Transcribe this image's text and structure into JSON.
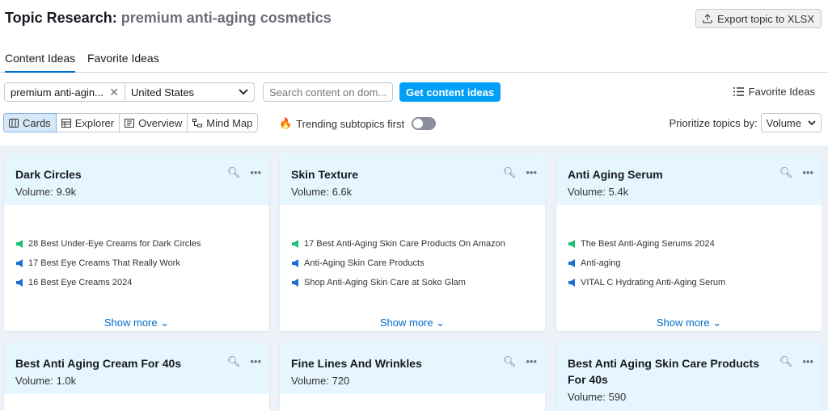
{
  "header": {
    "title": "Topic Research:",
    "query": "premium anti-aging cosmetics",
    "export_label": "Export topic to XLSX"
  },
  "tabs": [
    {
      "label": "Content Ideas",
      "active": true
    },
    {
      "label": "Favorite Ideas",
      "active": false
    }
  ],
  "filters": {
    "topic_chip": "premium anti-agin...",
    "country": "United States",
    "search_placeholder": "Search content on dom...",
    "go_label": "Get content ideas",
    "favorite_link": "Favorite Ideas"
  },
  "views": [
    {
      "label": "Cards",
      "icon": "cards-icon",
      "active": true
    },
    {
      "label": "Explorer",
      "icon": "table-icon",
      "active": false
    },
    {
      "label": "Overview",
      "icon": "overview-icon",
      "active": false
    },
    {
      "label": "Mind Map",
      "icon": "mindmap-icon",
      "active": false
    }
  ],
  "trending": {
    "label": "Trending subtopics first",
    "on": false
  },
  "prioritize": {
    "label": "Prioritize topics by:",
    "value": "Volume"
  },
  "colors": {
    "accent": "#009ff5",
    "link": "#006dca",
    "headline_green": "#1dbf7a",
    "headline_blue": "#1a6fd3"
  },
  "cards": [
    {
      "title": "Dark Circles",
      "volume": "Volume: 9.9k",
      "items": [
        {
          "text": "28 Best Under-Eye Creams for Dark Circles",
          "kind": "green"
        },
        {
          "text": "17 Best Eye Creams That Really Work",
          "kind": "blue"
        },
        {
          "text": "16 Best Eye Creams 2024",
          "kind": "blue"
        }
      ],
      "show_more": "Show more"
    },
    {
      "title": "Skin Texture",
      "volume": "Volume: 6.6k",
      "items": [
        {
          "text": "17 Best Anti-Aging Skin Care Products On Amazon",
          "kind": "green"
        },
        {
          "text": "Anti-Aging Skin Care Products",
          "kind": "blue"
        },
        {
          "text": "Shop Anti-Aging Skin Care at Soko Glam",
          "kind": "blue"
        }
      ],
      "show_more": "Show more"
    },
    {
      "title": "Anti Aging Serum",
      "volume": "Volume: 5.4k",
      "items": [
        {
          "text": "The Best Anti-Aging Serums 2024",
          "kind": "green"
        },
        {
          "text": "Anti-aging",
          "kind": "blue"
        },
        {
          "text": "VITAL C Hydrating Anti-Aging Serum",
          "kind": "blue"
        }
      ],
      "show_more": "Show more"
    },
    {
      "title": "Best Anti Aging Cream For 40s",
      "volume": "Volume: 1.0k"
    },
    {
      "title": "Fine Lines And Wrinkles",
      "volume": "Volume: 720"
    },
    {
      "title": "Best Anti Aging Skin Care Products For 40s",
      "volume": "Volume: 590"
    }
  ]
}
